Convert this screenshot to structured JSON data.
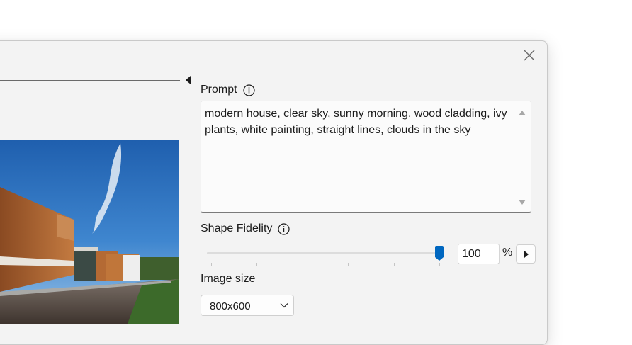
{
  "prompt": {
    "label": "Prompt",
    "text": "modern house, clear sky, sunny morning, wood cladding, ivy plants, white painting, straight lines, clouds in the sky"
  },
  "shape_fidelity": {
    "label": "Shape Fidelity",
    "value": "100",
    "unit": "%",
    "level_percent": 100
  },
  "image_size": {
    "label": "Image size",
    "selected": "800x600"
  },
  "icons": {
    "close": "close-icon",
    "info": "info-icon",
    "collapse": "collapse-left-icon",
    "step": "play-right-icon",
    "dropdown": "chevron-down-icon"
  },
  "colors": {
    "accent": "#0067c0",
    "dialog_bg": "#f3f3f3"
  }
}
